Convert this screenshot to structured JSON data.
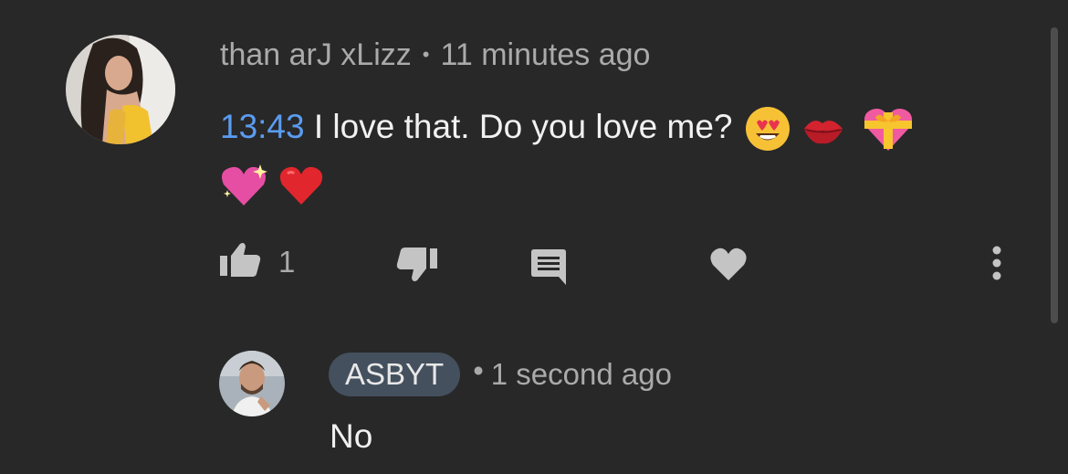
{
  "comment": {
    "author": "than arJ xLizz",
    "separator": "•",
    "time": "11 minutes ago",
    "timestamp_link": "13:43",
    "text": " I love that. Do you love me? ",
    "emojis": [
      "heart-eyes-emoji",
      "kiss-mark-emoji",
      "heart-with-ribbon-emoji",
      "sparkling-heart-emoji",
      "red-heart-emoji"
    ],
    "like_count": "1"
  },
  "icons": {
    "like": "thumbs-up-icon",
    "dislike": "thumbs-down-icon",
    "reply": "reply-icon",
    "heart": "heart-icon",
    "more": "more-vert-icon"
  },
  "reply": {
    "author": "ASBYT",
    "separator": "•",
    "time": "1 second ago",
    "text": "No"
  },
  "colors": {
    "background": "#282828",
    "link": "#5b9cf1",
    "text": "#f1f1f1",
    "secondary": "#aaaaaa",
    "badge": "#44505e"
  }
}
